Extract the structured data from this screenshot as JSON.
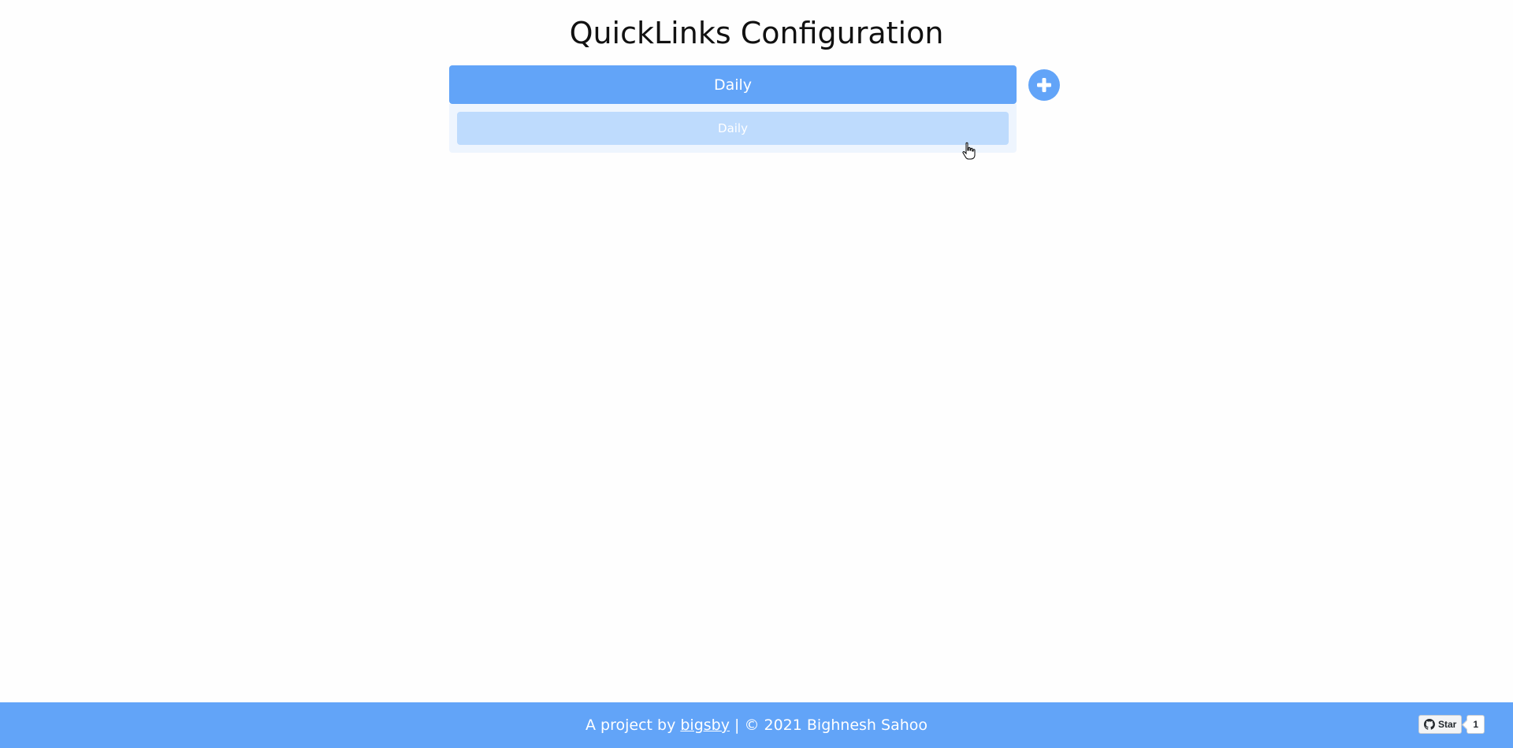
{
  "page": {
    "title": "QuickLinks Configuration"
  },
  "groups": [
    {
      "name": "Daily",
      "links": [
        {
          "label": "Daily"
        }
      ]
    }
  ],
  "add_button": {
    "icon": "plus-icon"
  },
  "footer": {
    "prefix": "A project by ",
    "author_link": "bigsby",
    "suffix": " | © 2021 Bighnesh Sahoo",
    "github": {
      "star_label": "Star",
      "star_count": "1",
      "icon": "github-icon"
    }
  },
  "colors": {
    "accent": "#62a4f8",
    "link_item": "#bedbfd",
    "group_body": "#eef5fe",
    "background": "#fefefe"
  }
}
